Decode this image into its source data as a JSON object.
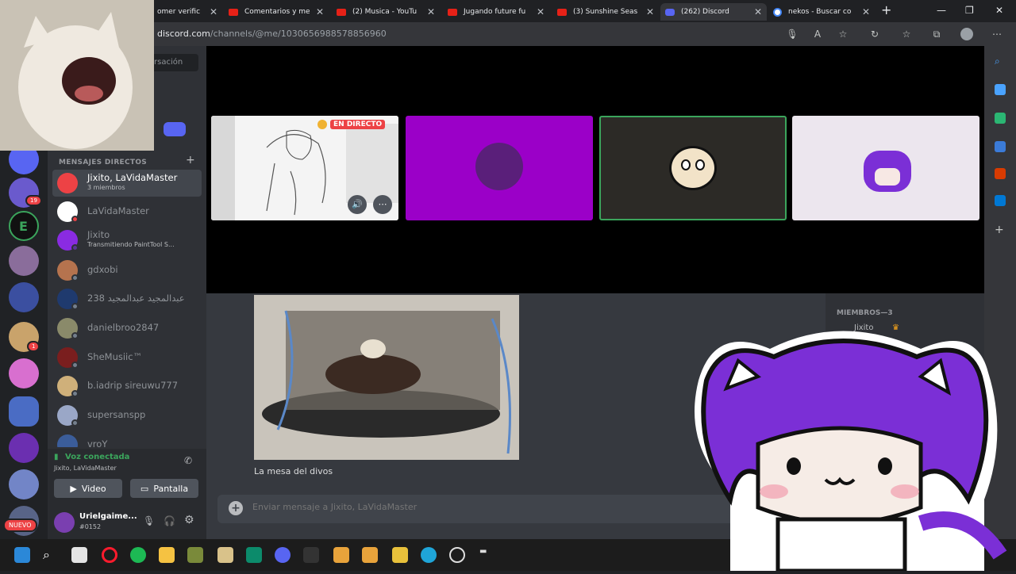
{
  "browser": {
    "tabs": [
      {
        "title": "omer verific",
        "icon": "doc-icon"
      },
      {
        "title": "Comentarios y me",
        "icon": "youtube-icon"
      },
      {
        "title": "(2) Musica - YouTu",
        "icon": "youtube-icon"
      },
      {
        "title": "Jugando future fu",
        "icon": "youtube-icon"
      },
      {
        "title": "(3) Sunshine Seas",
        "icon": "youtube-icon"
      },
      {
        "title": "(262) Discord",
        "icon": "discord-icon"
      },
      {
        "title": "nekos - Buscar co",
        "icon": "google-icon"
      }
    ],
    "url_domain": "discord.com",
    "url_path": "/channels/@me/1030656988578856960"
  },
  "rail": {
    "badges": [
      "19",
      "1",
      "NUEVO"
    ]
  },
  "sidebar": {
    "search_placeholder": "rsación",
    "dm_header": "MENSAJES DIRECTOS",
    "dms": [
      {
        "name": "Jixito, LaVidaMaster",
        "sub": "3 miembros",
        "selected": true
      },
      {
        "name": "LaVidaMaster",
        "sub": ""
      },
      {
        "name": "Jixito",
        "sub": "Transmitiendo PaintTool S..."
      },
      {
        "name": "gdxobi",
        "sub": ""
      },
      {
        "name": "238 عبدالمجيد عبدالمجيد",
        "sub": ""
      },
      {
        "name": "danielbroo2847",
        "sub": ""
      },
      {
        "name": "SheMusiic™",
        "sub": ""
      },
      {
        "name": "b.iadrip sireuwu777",
        "sub": ""
      },
      {
        "name": "supersanspp",
        "sub": ""
      },
      {
        "name": "vroY",
        "sub": ""
      }
    ],
    "voice": {
      "title": "Voz conectada",
      "sub": "Jixito, LaVidaMaster",
      "video_label": "Video",
      "screen_label": "Pantalla"
    },
    "user": {
      "name": "Urielgaime...",
      "tag": "#0152"
    }
  },
  "stage": {
    "live_label": "EN DIRECTO"
  },
  "chat": {
    "caption": "La mesa del divos",
    "input_placeholder": "Enviar mensaje a Jixito, LaVidaMaster"
  },
  "members": {
    "header": "MIEMBROS—3",
    "first": "Jixito"
  },
  "colors": {
    "discord_dark": "#202225",
    "sidebar": "#2f3136",
    "chat": "#36393f",
    "purple_tile": "#9b00c8",
    "accent_green": "#3ba55c"
  }
}
